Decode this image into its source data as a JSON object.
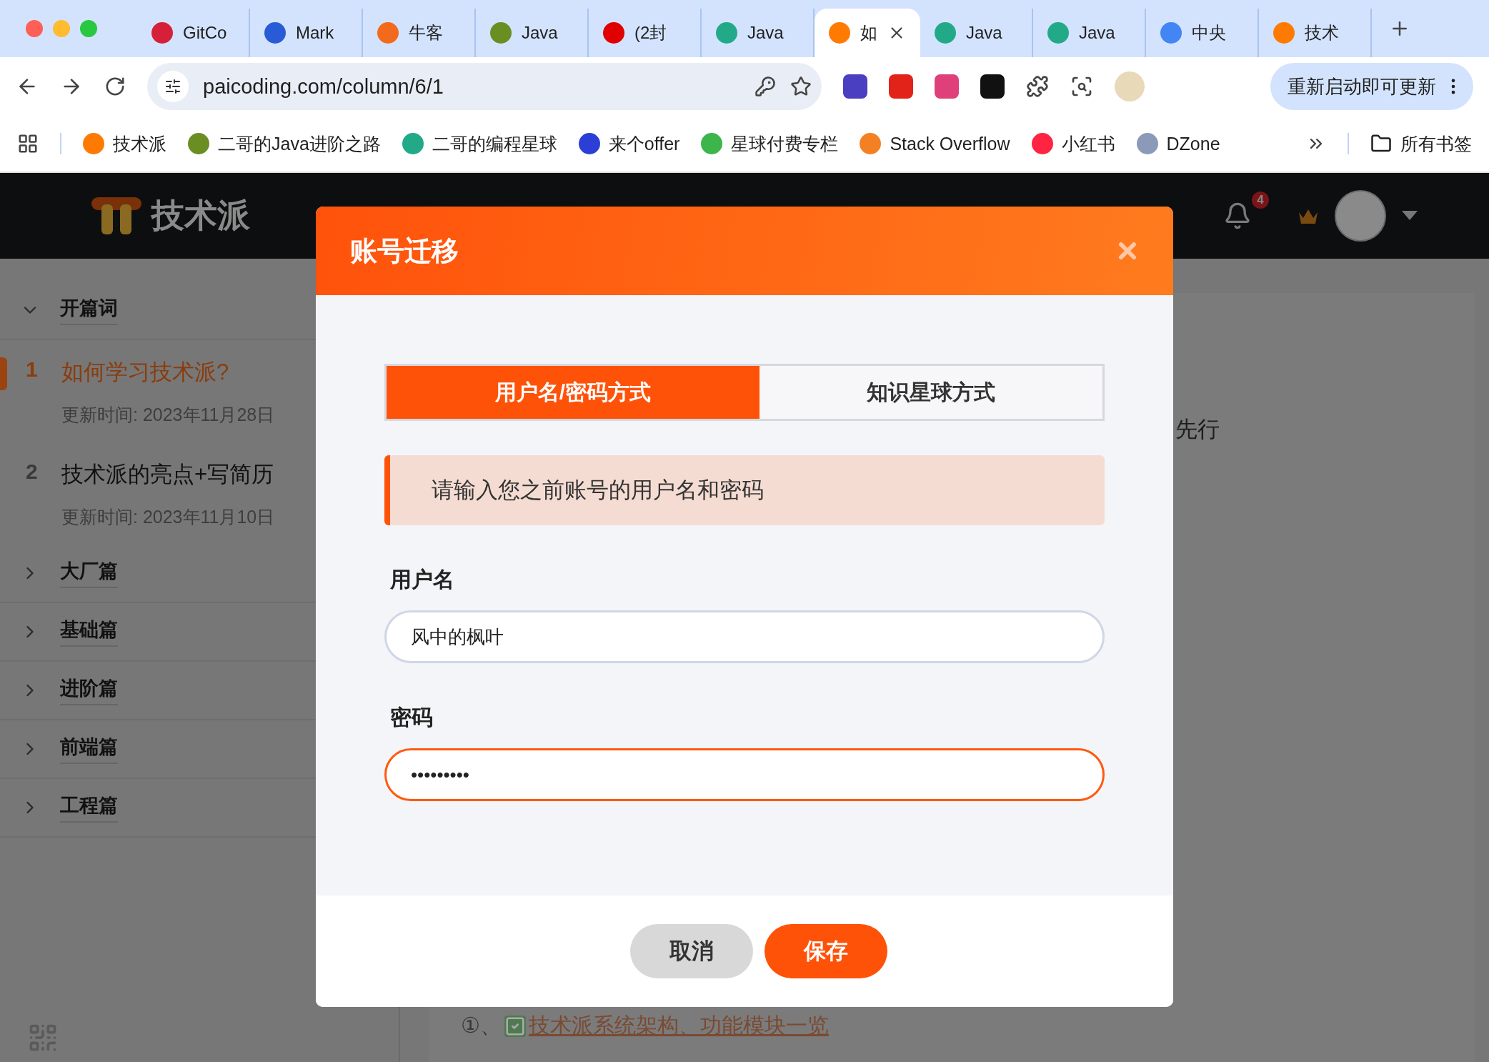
{
  "browser": {
    "tabs": [
      {
        "title": "GitCo",
        "color": "#d6203a",
        "selected": false
      },
      {
        "title": "Mark",
        "color": "#2a5bd7",
        "selected": false
      },
      {
        "title": "牛客",
        "color": "#f26b1d",
        "selected": false
      },
      {
        "title": "Java",
        "color": "#6b8e23",
        "selected": false
      },
      {
        "title": "(2封",
        "color": "#e00000",
        "selected": false
      },
      {
        "title": "Java",
        "color": "#22aa88",
        "selected": false
      },
      {
        "title": "如",
        "color": "#ff7a00",
        "selected": true
      },
      {
        "title": "Java",
        "color": "#22aa88",
        "selected": false
      },
      {
        "title": "Java",
        "color": "#22aa88",
        "selected": false
      },
      {
        "title": "中央",
        "color": "#4285f4",
        "selected": false
      },
      {
        "title": "技术",
        "color": "#ff7a00",
        "selected": false
      }
    ],
    "url": "paicoding.com/column/6/1",
    "update_button": "重新启动即可更新",
    "bookmarks": [
      {
        "label": "技术派",
        "color": "#ff7a00"
      },
      {
        "label": "二哥的Java进阶之路",
        "color": "#6b8e23"
      },
      {
        "label": "二哥的编程星球",
        "color": "#22aa88"
      },
      {
        "label": "来个offer",
        "color": "#2b3fd6"
      },
      {
        "label": "星球付费专栏",
        "color": "#3cb54a"
      },
      {
        "label": "Stack Overflow",
        "color": "#f48024"
      },
      {
        "label": "小红书",
        "color": "#ff2442"
      },
      {
        "label": "DZone",
        "color": "#8a9ab8"
      }
    ],
    "all_bookmarks": "所有书签"
  },
  "site": {
    "logo": "技术派",
    "notification_count": "4",
    "sidebar": [
      {
        "title": "开篇词",
        "expanded": true,
        "children": [
          {
            "number": "1",
            "title": "如何学习技术派?",
            "updated": "更新时间: 2023年11月28日",
            "selected": true
          },
          {
            "number": "2",
            "title": "技术派的亮点+写简历",
            "updated": "更新时间: 2023年11月10日",
            "selected": false
          }
        ]
      },
      {
        "title": "大厂篇",
        "expanded": false
      },
      {
        "title": "基础篇",
        "expanded": false
      },
      {
        "title": "进阶篇",
        "expanded": false
      },
      {
        "title": "前端篇",
        "expanded": false
      },
      {
        "title": "工程篇",
        "expanded": false
      }
    ],
    "content_fragment": "先行",
    "list_item": {
      "marker": "①、",
      "link": "技术派系统架构、功能模块一览"
    }
  },
  "dialog": {
    "title": "账号迁移",
    "tabs": [
      {
        "label": "用户名/密码方式",
        "selected": true
      },
      {
        "label": "知识星球方式",
        "selected": false
      }
    ],
    "notice": "请输入您之前账号的用户名和密码",
    "fields": [
      {
        "label": "用户名",
        "value": "风中的枫叶",
        "focused": false
      },
      {
        "label": "密码",
        "value": "•••••••••",
        "focused": true
      }
    ],
    "buttons": [
      {
        "label": "取消",
        "kind": "secondary"
      },
      {
        "label": "保存",
        "kind": "primary"
      }
    ]
  }
}
